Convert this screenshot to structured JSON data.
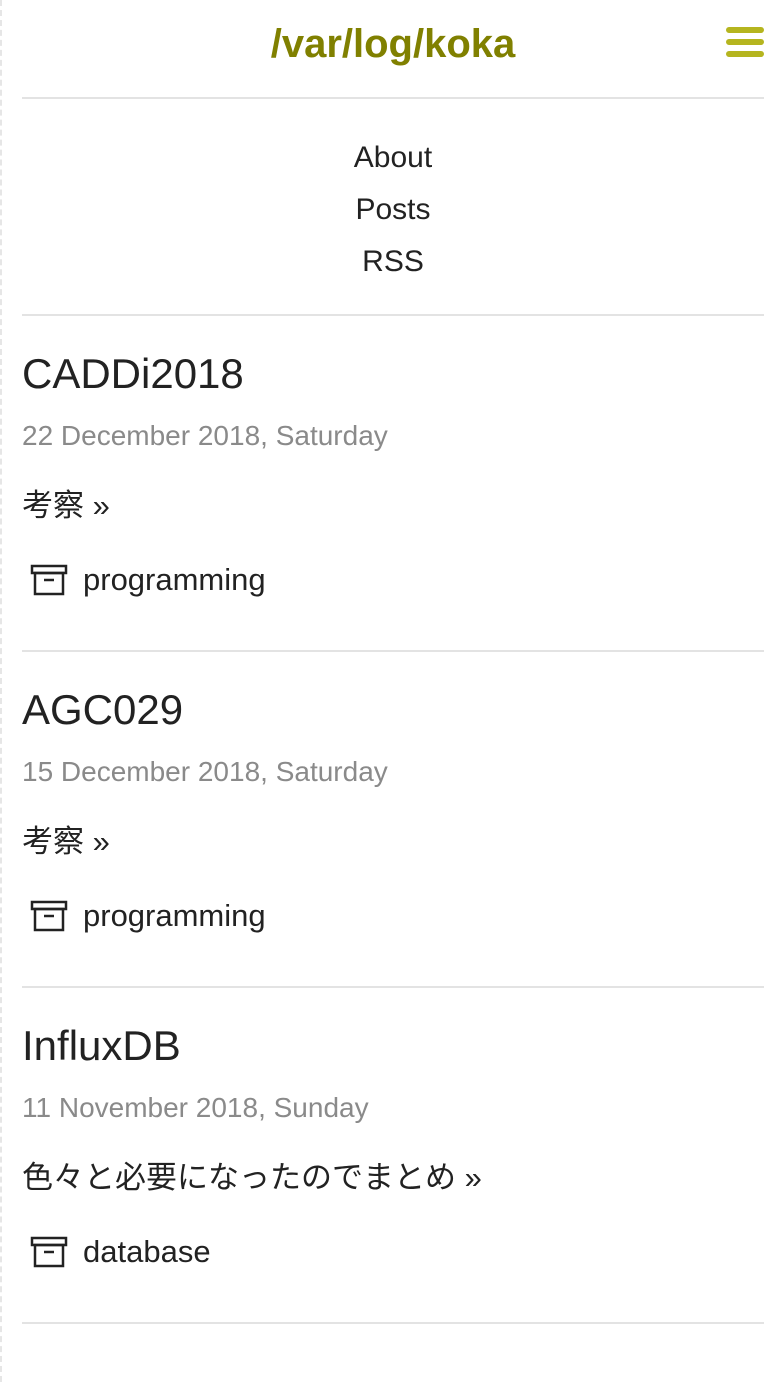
{
  "site": {
    "title": "/var/log/koka"
  },
  "nav": {
    "items": [
      {
        "label": "About"
      },
      {
        "label": "Posts"
      },
      {
        "label": "RSS"
      }
    ]
  },
  "posts": [
    {
      "title": "CADDi2018",
      "date": "22 December 2018, Saturday",
      "excerpt": "考察 »",
      "category": "programming",
      "category_icon": "archive-icon"
    },
    {
      "title": "AGC029",
      "date": "15 December 2018, Saturday",
      "excerpt": "考察 »",
      "category": "programming",
      "category_icon": "archive-icon"
    },
    {
      "title": "InfluxDB",
      "date": "11 November 2018, Sunday",
      "excerpt": "色々と必要になったのでまとめ »",
      "category": "database",
      "category_icon": "archive-icon"
    }
  ],
  "colors": {
    "brand": "#808000",
    "menu_icon": "#b5b51f",
    "date_text": "#8a8a8a",
    "divider": "#e3e3e3"
  },
  "icons": {
    "menu": "hamburger-menu-icon"
  }
}
